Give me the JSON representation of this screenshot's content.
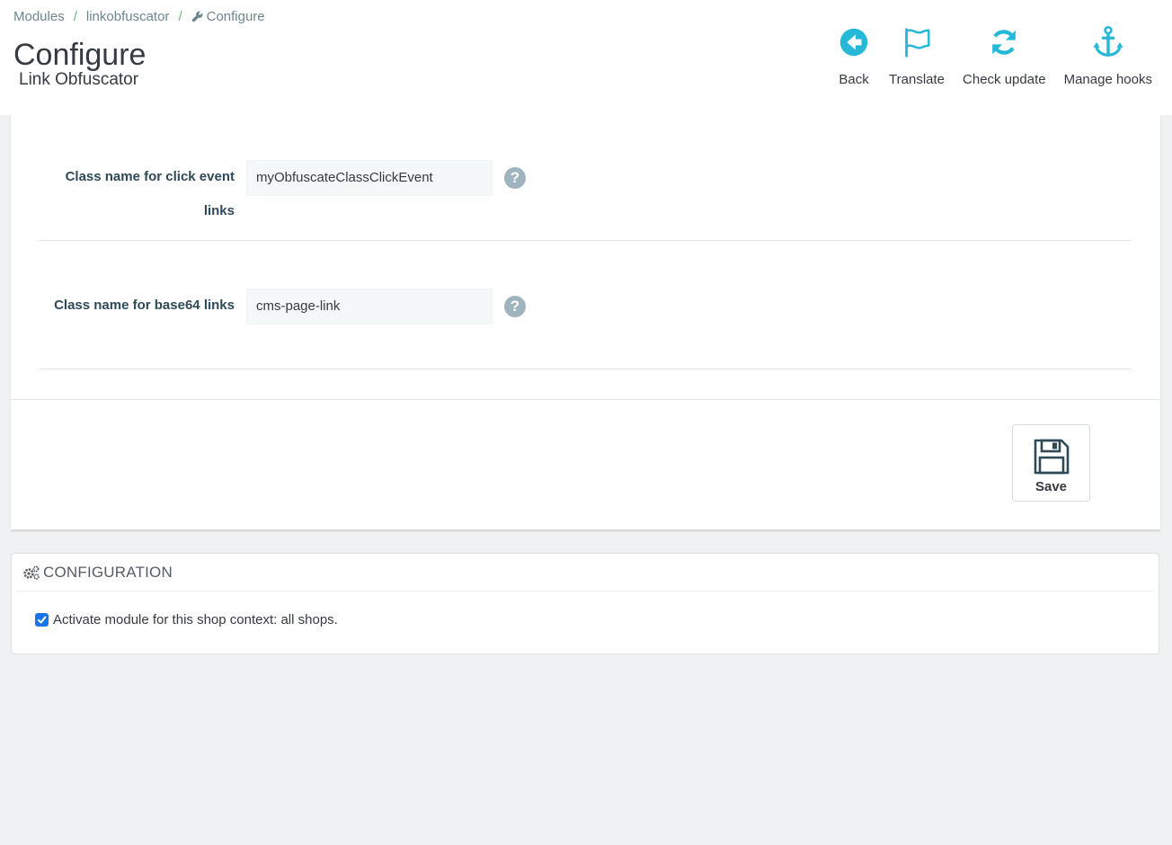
{
  "breadcrumb": {
    "items": [
      "Modules",
      "linkobfuscator"
    ],
    "current": "Configure"
  },
  "header": {
    "title": "Configure",
    "subtitle": "Link Obfuscator"
  },
  "toolbar": {
    "back": "Back",
    "translate": "Translate",
    "check_update": "Check update",
    "manage_hooks": "Manage hooks"
  },
  "form": {
    "fields": [
      {
        "label": "Class name for click event links",
        "value": "myObfuscateClassClickEvent"
      },
      {
        "label": "Class name for base64 links",
        "value": "cms-page-link"
      }
    ],
    "help_glyph": "?",
    "save_label": "Save"
  },
  "config": {
    "title": "CONFIGURATION",
    "activate_label": "Activate module for this shop context: all shops.",
    "activate_checked": true
  },
  "colors": {
    "accent": "#25b9d7",
    "label": "#2e4a58",
    "separator": "#70b580"
  }
}
